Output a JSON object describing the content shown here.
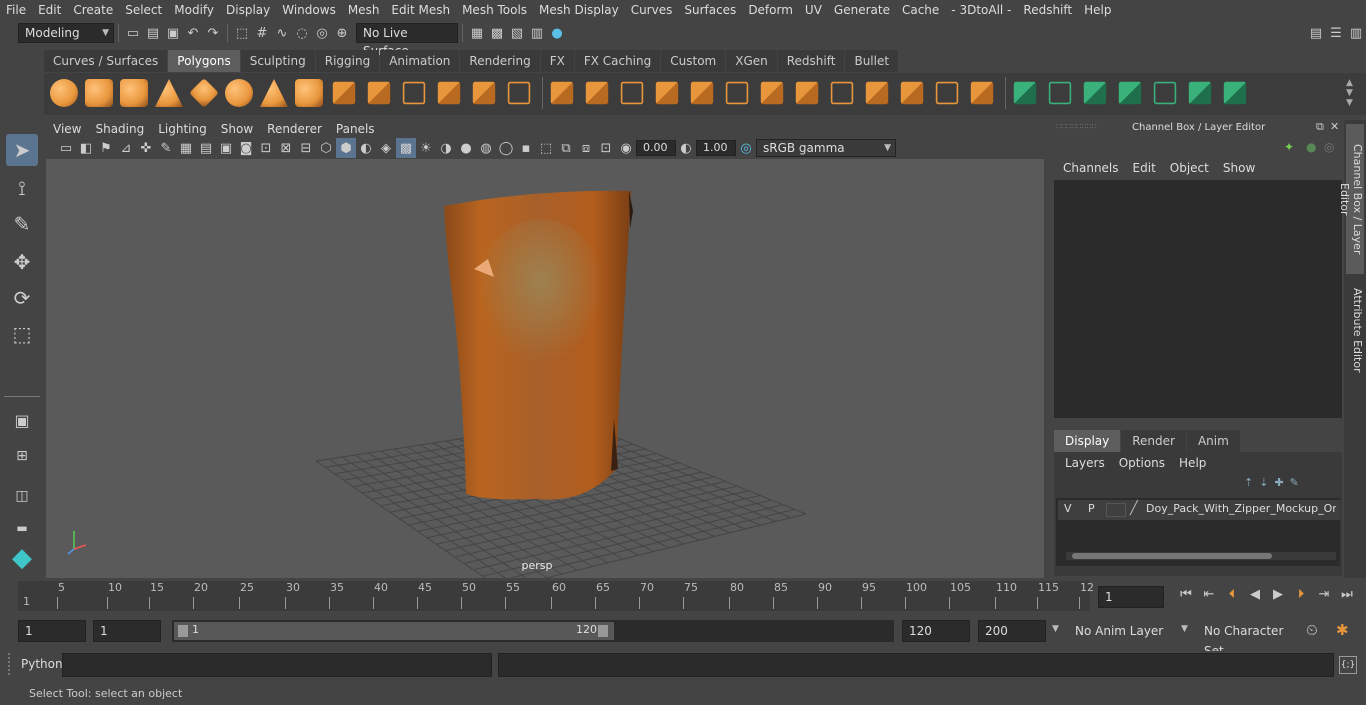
{
  "menubar": {
    "items": [
      "File",
      "Edit",
      "Create",
      "Select",
      "Modify",
      "Display",
      "Windows",
      "Mesh",
      "Edit Mesh",
      "Mesh Tools",
      "Mesh Display",
      "Curves",
      "Surfaces",
      "Deform",
      "UV",
      "Generate",
      "Cache",
      "- 3DtoAll -",
      "Redshift",
      "Help"
    ]
  },
  "status": {
    "mode": "Modeling",
    "live_surface": "No Live Surface"
  },
  "shelf": {
    "tabs": [
      "Curves / Surfaces",
      "Polygons",
      "Sculpting",
      "Rigging",
      "Animation",
      "Rendering",
      "FX",
      "FX Caching",
      "Custom",
      "XGen",
      "Redshift",
      "Bullet"
    ],
    "active": "Polygons"
  },
  "viewport": {
    "menu": [
      "View",
      "Shading",
      "Lighting",
      "Show",
      "Renderer",
      "Panels"
    ],
    "exposure": "0.00",
    "gamma": "1.00",
    "color_space": "sRGB gamma",
    "camera_label": "persp"
  },
  "channel_box": {
    "title": "Channel Box / Layer Editor",
    "menu": [
      "Channels",
      "Edit",
      "Object",
      "Show"
    ],
    "tabs": [
      "Display",
      "Render",
      "Anim"
    ],
    "active_tab": "Display",
    "layer_menu": [
      "Layers",
      "Options",
      "Help"
    ],
    "layer": {
      "v": "V",
      "p": "P",
      "name": "Doy_Pack_With_Zipper_Mockup_Orange"
    }
  },
  "side_tabs": [
    "Channel Box / Layer Editor",
    "Attribute Editor"
  ],
  "timeline": {
    "ticks": [
      "5",
      "10",
      "15",
      "20",
      "25",
      "30",
      "35",
      "40",
      "45",
      "50",
      "55",
      "60",
      "65",
      "70",
      "75",
      "80",
      "85",
      "90",
      "95",
      "100",
      "105",
      "110",
      "115",
      "12"
    ],
    "start_marker": "1",
    "current_frame": "1"
  },
  "range": {
    "start": "1",
    "playback_start": "1",
    "slider_start": "1",
    "slider_end": "120",
    "end": "120",
    "anim_end": "200",
    "anim_layer": "No Anim Layer",
    "character_set": "No Character Set"
  },
  "cmdline": {
    "language": "Python"
  },
  "help": {
    "text": "Select Tool: select an object"
  },
  "colors": {
    "accent": "#5b9bd5",
    "shelf_orange": "#e8963c",
    "shelf_green": "#3ab07a",
    "pouch": "#b5601f"
  }
}
